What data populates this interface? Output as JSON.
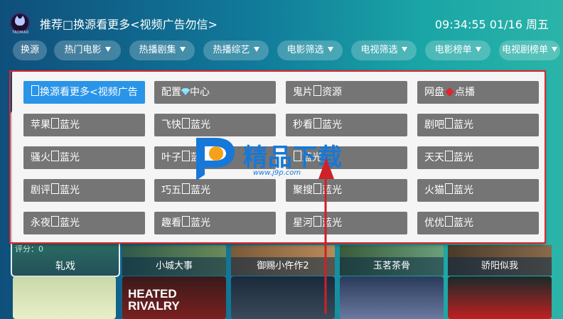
{
  "app": {
    "logo_text": "TAOMAO",
    "title": "推荐□换源看更多<视频广告勿信>",
    "clock": "09:34:55 01/16 周五"
  },
  "tabs": [
    {
      "label": "换源",
      "arrow": false
    },
    {
      "label": "热门电影",
      "arrow": true
    },
    {
      "label": "热播剧集",
      "arrow": true
    },
    {
      "label": "热播综艺",
      "arrow": true
    },
    {
      "label": "电影筛选",
      "arrow": true
    },
    {
      "label": "电视筛选",
      "arrow": true
    },
    {
      "label": "电影榜单",
      "arrow": true
    },
    {
      "label": "电视剧榜单",
      "arrow": true
    }
  ],
  "sources": [
    {
      "text": "换源看更多<视频广告",
      "prefix_sq": true,
      "active": true
    },
    {
      "text": "配置",
      "suffix": "中心",
      "gem": true
    },
    {
      "text": "鬼片",
      "suffix": "资源",
      "mid_sq": true
    },
    {
      "text": "网盘",
      "suffix": "点播",
      "diamond": true
    },
    {
      "text": "苹果",
      "suffix": "蓝光",
      "mid_sq": true
    },
    {
      "text": "飞快",
      "suffix": "蓝光",
      "mid_sq": true
    },
    {
      "text": "秒看",
      "suffix": "蓝光",
      "mid_sq": true
    },
    {
      "text": "剧吧",
      "suffix": "蓝光",
      "mid_sq": true
    },
    {
      "text": "骚火",
      "suffix": "蓝光",
      "mid_sq": true
    },
    {
      "text": "叶子",
      "suffix": "蓝光",
      "mid_sq": true
    },
    {
      "text": "",
      "suffix": "蓝光",
      "mid_sq": true
    },
    {
      "text": "天天",
      "suffix": "蓝光",
      "mid_sq": true
    },
    {
      "text": "剧评",
      "suffix": "蓝光",
      "mid_sq": true
    },
    {
      "text": "巧五",
      "suffix": "蓝光",
      "mid_sq": true
    },
    {
      "text": "聚搜",
      "suffix": "蓝光",
      "mid_sq": true
    },
    {
      "text": "火猫",
      "suffix": "蓝光",
      "mid_sq": true
    },
    {
      "text": "永夜",
      "suffix": "蓝光",
      "mid_sq": true
    },
    {
      "text": "趣看",
      "suffix": "蓝光",
      "mid_sq": true
    },
    {
      "text": "星河",
      "suffix": "蓝光",
      "mid_sq": true
    },
    {
      "text": "优优",
      "suffix": "蓝光",
      "mid_sq": true
    }
  ],
  "background": {
    "focused_label": "轧戏",
    "focused_score": "评分：0",
    "row_labels": [
      "小城大事",
      "御赐小仵作2",
      "玉茗茶骨",
      "骄阳似我"
    ],
    "poster_texts": [
      "HEATED RIVALRY"
    ]
  },
  "watermark": {
    "text": "精品下载",
    "url": "www.j9p.com"
  },
  "colors": {
    "active": "#2a94e8",
    "button": "#757575",
    "outline": "#e0262e",
    "watermark": "#1678d8"
  }
}
